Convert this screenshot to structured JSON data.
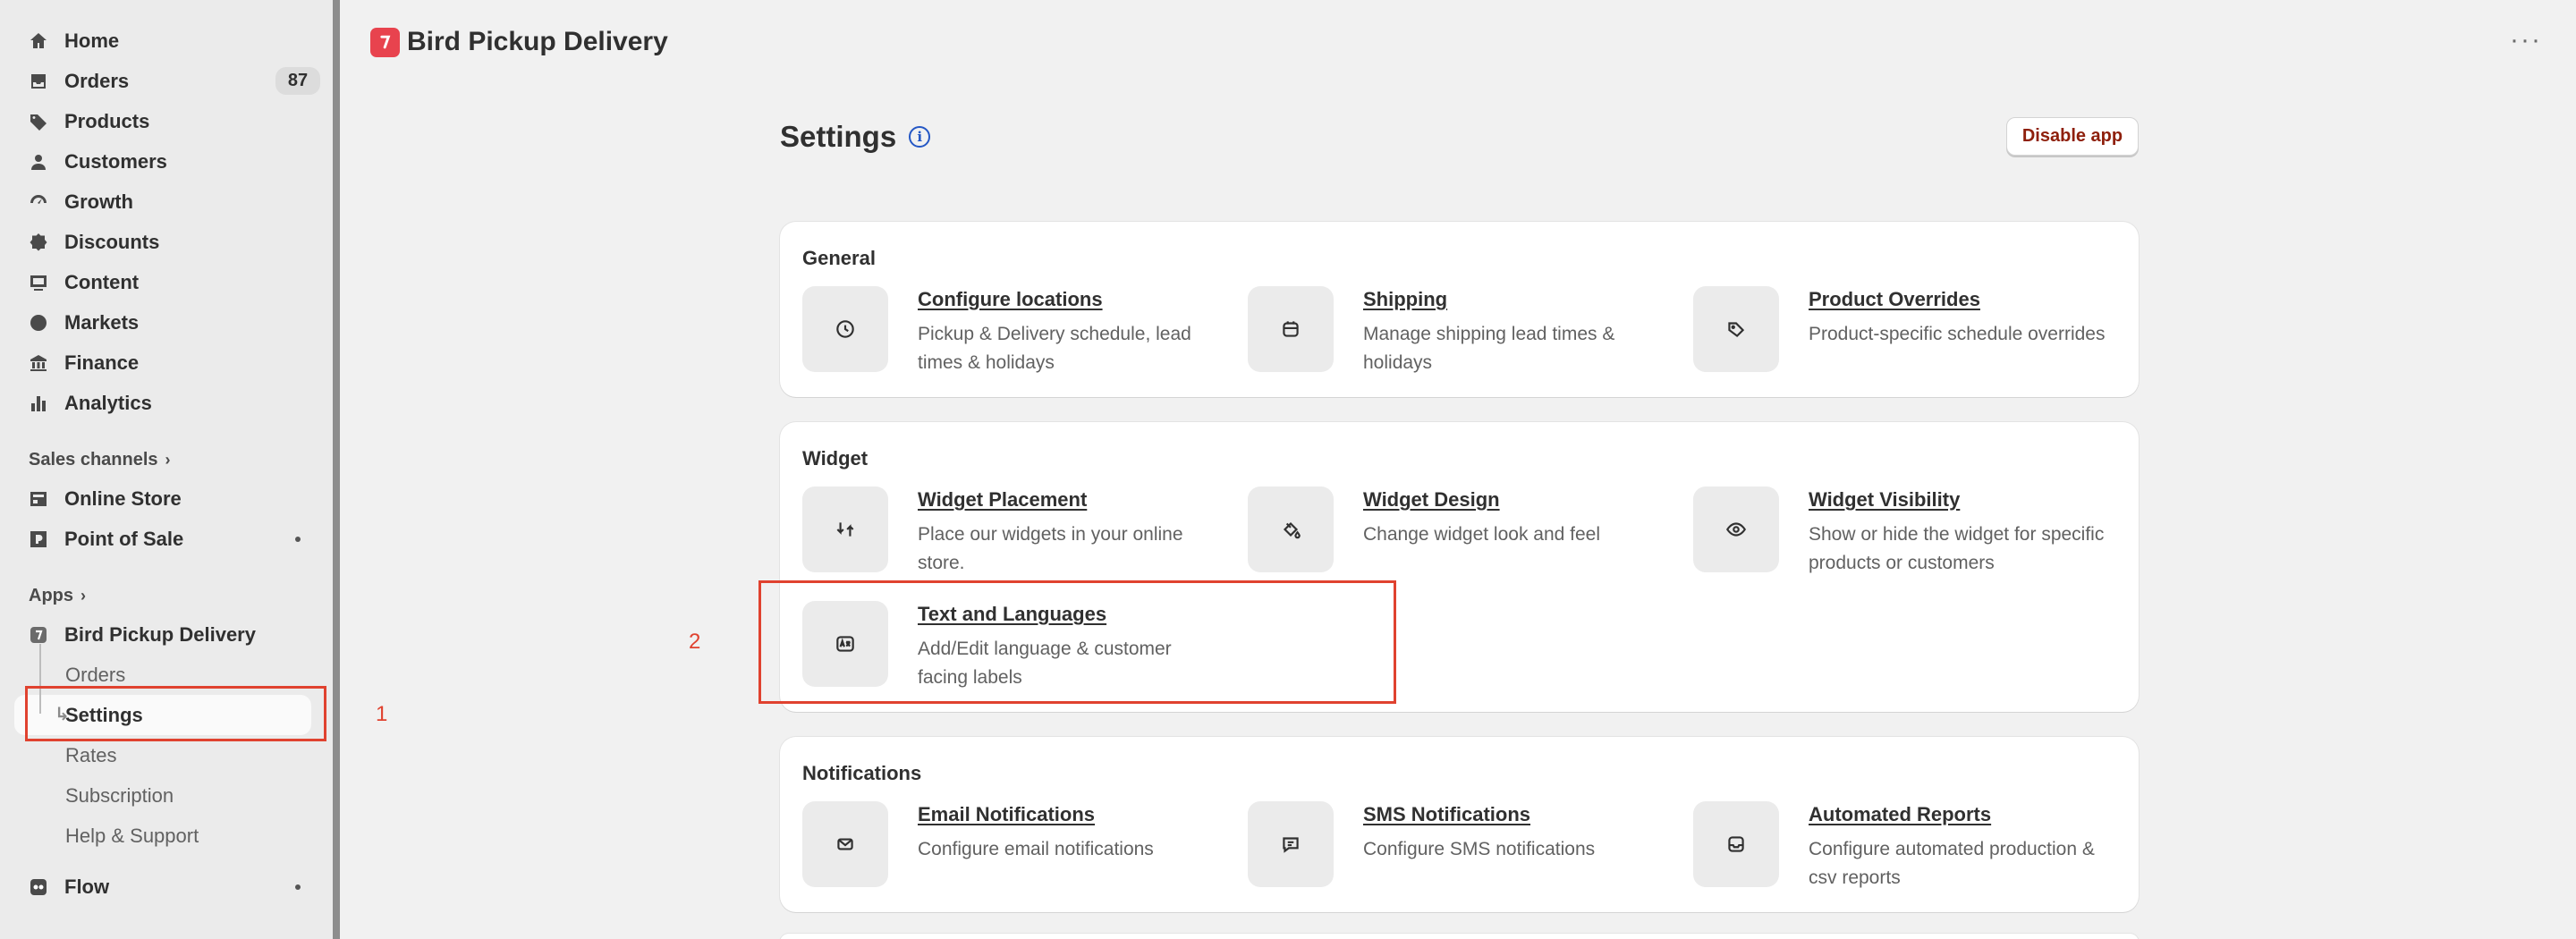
{
  "sidebar": {
    "items": [
      {
        "label": "Home",
        "icon": "home-icon"
      },
      {
        "label": "Orders",
        "icon": "orders-icon",
        "badge": "87"
      },
      {
        "label": "Products",
        "icon": "tag-icon"
      },
      {
        "label": "Customers",
        "icon": "person-icon"
      },
      {
        "label": "Growth",
        "icon": "gauge-icon"
      },
      {
        "label": "Discounts",
        "icon": "discount-icon"
      },
      {
        "label": "Content",
        "icon": "content-icon"
      },
      {
        "label": "Markets",
        "icon": "globe-icon"
      },
      {
        "label": "Finance",
        "icon": "bank-icon"
      },
      {
        "label": "Analytics",
        "icon": "bar-chart-icon"
      }
    ],
    "sales_channels_label": "Sales channels",
    "sales_channels": [
      {
        "label": "Online Store",
        "icon": "store-icon"
      },
      {
        "label": "Point of Sale",
        "icon": "pos-icon"
      }
    ],
    "apps_label": "Apps",
    "app_name": "Bird Pickup Delivery",
    "app_subitems": [
      "Orders",
      "Settings",
      "Rates",
      "Subscription",
      "Help & Support"
    ],
    "flow_label": "Flow"
  },
  "header": {
    "app_title": "Bird Pickup Delivery",
    "more": "···"
  },
  "main": {
    "title": "Settings",
    "info_icon": "i",
    "disable_button": "Disable app",
    "sections": [
      {
        "title": "General",
        "tiles": [
          {
            "name": "Configure locations",
            "desc": "Pickup & Delivery schedule, lead times & holidays",
            "icon": "clock-icon"
          },
          {
            "name": "Shipping",
            "desc": "Manage shipping lead times & holidays",
            "icon": "calendar-icon"
          },
          {
            "name": "Product Overrides",
            "desc": "Product-specific schedule overrides",
            "icon": "tag-icon"
          }
        ]
      },
      {
        "title": "Widget",
        "tiles": [
          {
            "name": "Widget Placement",
            "desc": "Place our widgets in your online store.",
            "icon": "arrows-icon"
          },
          {
            "name": "Widget Design",
            "desc": "Change widget look and feel",
            "icon": "paint-bucket-icon"
          },
          {
            "name": "Widget Visibility",
            "desc": "Show or hide the widget for specific products or customers",
            "icon": "eye-icon"
          },
          {
            "name": "Text and Languages",
            "desc": "Add/Edit language & customer facing labels",
            "icon": "language-icon"
          }
        ]
      },
      {
        "title": "Notifications",
        "tiles": [
          {
            "name": "Email Notifications",
            "desc": "Configure email notifications",
            "icon": "envelope-icon"
          },
          {
            "name": "SMS Notifications",
            "desc": "Configure SMS notifications",
            "icon": "chat-icon"
          },
          {
            "name": "Automated Reports",
            "desc": "Configure automated production & csv reports",
            "icon": "inbox-icon"
          }
        ]
      }
    ]
  },
  "annotations": {
    "label_1": "1",
    "label_2": "2"
  },
  "colors": {
    "accent_red": "#e0422f",
    "logo_red": "#e8434e",
    "link_blue": "#2457c5",
    "disable_text": "#8e1f0b"
  }
}
